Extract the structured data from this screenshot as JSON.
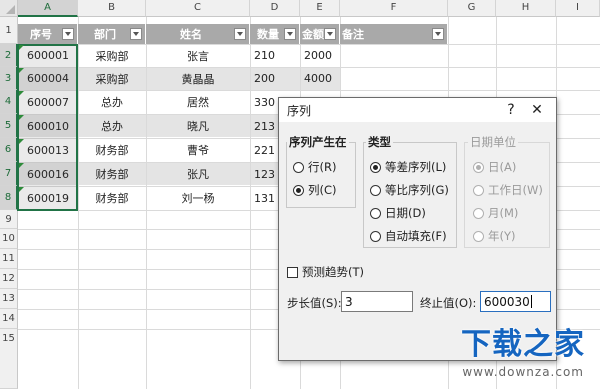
{
  "columns": [
    "A",
    "B",
    "C",
    "D",
    "E",
    "F",
    "G",
    "H",
    "I"
  ],
  "rows": [
    "1",
    "2",
    "3",
    "4",
    "5",
    "6",
    "7",
    "8",
    "9",
    "10",
    "11",
    "12",
    "13",
    "14",
    "15"
  ],
  "table": {
    "headers": [
      "序号",
      "部门",
      "姓名",
      "数量",
      "金额",
      "备注"
    ],
    "records": [
      [
        "600001",
        "采购部",
        "张言",
        "210",
        "2000",
        ""
      ],
      [
        "600004",
        "采购部",
        "黄晶晶",
        "200",
        "4000",
        ""
      ],
      [
        "600007",
        "总办",
        "居然",
        "330",
        "",
        ""
      ],
      [
        "600010",
        "总办",
        "晓凡",
        "213",
        "",
        ""
      ],
      [
        "600013",
        "财务部",
        "曹爷",
        "221",
        "",
        ""
      ],
      [
        "600016",
        "财务部",
        "张凡",
        "123",
        "",
        ""
      ],
      [
        "600019",
        "财务部",
        "刘一杨",
        "131",
        "",
        ""
      ]
    ]
  },
  "dialog": {
    "title": "序列",
    "help": "?",
    "close": "✕",
    "series_in": {
      "label": "序列产生在",
      "options": [
        "行(R)",
        "列(C)"
      ],
      "selected": "列(C)"
    },
    "type": {
      "label": "类型",
      "options": [
        "等差序列(L)",
        "等比序列(G)",
        "日期(D)",
        "自动填充(F)"
      ],
      "selected": "等差序列(L)"
    },
    "date_unit": {
      "label": "日期单位",
      "options": [
        "日(A)",
        "工作日(W)",
        "月(M)",
        "年(Y)"
      ],
      "selected": "日(A)",
      "disabled": true
    },
    "trend": {
      "label": "预测趋势(T)",
      "checked": false
    },
    "step": {
      "label": "步长值(S):",
      "value": "3"
    },
    "stop": {
      "label": "终止值(O):",
      "value": "600030"
    }
  },
  "watermark": {
    "main": "下载之家",
    "sub": "www.downza.com"
  }
}
